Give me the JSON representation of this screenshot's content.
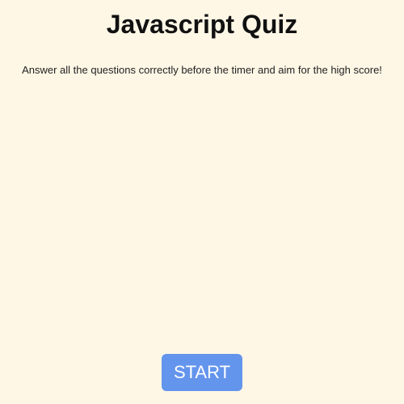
{
  "header": {
    "title": "Javascript Quiz"
  },
  "intro": {
    "text": "Answer all the questions correctly before the timer and aim for the high score!"
  },
  "controls": {
    "start_label": "START"
  },
  "colors": {
    "background": "#fff7e6",
    "button_bg": "#6495ed",
    "button_text": "#ffffff",
    "text": "#111111"
  }
}
